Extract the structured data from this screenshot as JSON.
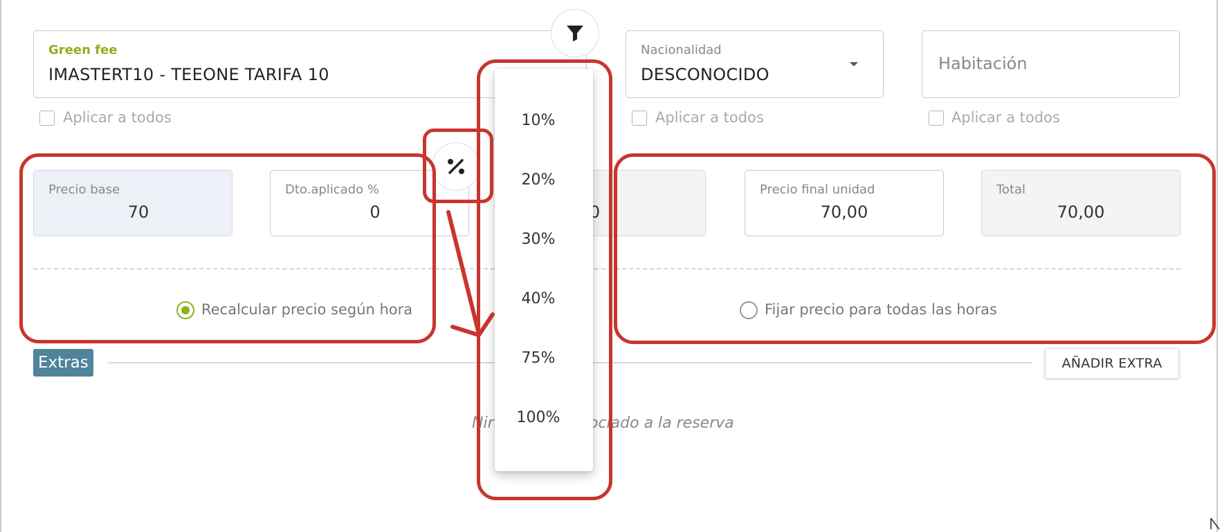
{
  "fields": {
    "green_fee": {
      "label": "Green fee",
      "value": "IMASTERT10 - TEEONE TARIFA 10",
      "apply_all": "Aplicar a todos"
    },
    "nacionalidad": {
      "label": "Nacionalidad",
      "value": "DESCONOCIDO",
      "apply_all": "Aplicar a todos"
    },
    "habitacion": {
      "placeholder": "Habitación",
      "apply_all": "Aplicar a todos"
    }
  },
  "prices": {
    "base": {
      "label": "Precio base",
      "value": "70"
    },
    "discount": {
      "label": "Dto.aplicado %",
      "value": "0"
    },
    "hidden_partial_value": ",00",
    "final_unit": {
      "label": "Precio final unidad",
      "value": "70,00"
    },
    "total": {
      "label": "Total",
      "value": "70,00"
    }
  },
  "radios": {
    "recalc": {
      "label": "Recalcular precio según hora",
      "selected": true
    },
    "fixed": {
      "label": "Fijar precio para todas las horas",
      "selected": false
    }
  },
  "extras": {
    "tag": "Extras",
    "add_button": "AÑADIR EXTRA",
    "empty_left": "Nir",
    "empty_right": "ociado a la reserva"
  },
  "discount_menu": {
    "options": [
      "10%",
      "20%",
      "30%",
      "40%",
      "75%",
      "100%"
    ]
  },
  "icons": {
    "filter": "filter-icon",
    "percent": "percent-icon",
    "dropdown": "chevron-down-icon"
  },
  "colors": {
    "accent_green": "#8fb01c",
    "extras_tag": "#4f849b",
    "annotation_red": "#c8352e"
  }
}
